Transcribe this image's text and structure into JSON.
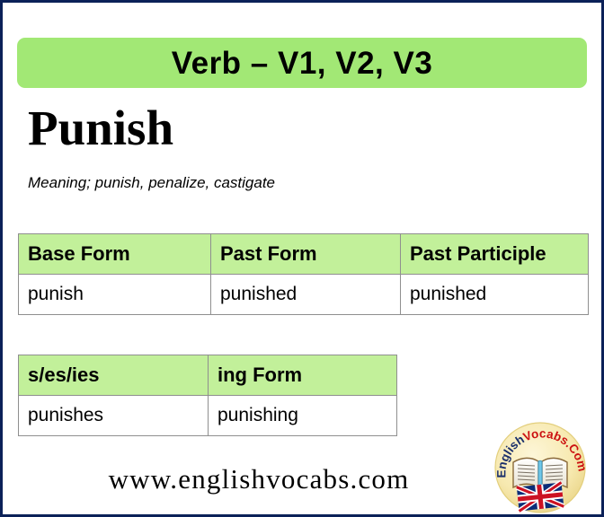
{
  "banner": {
    "title": "Verb – V1, V2, V3"
  },
  "word": {
    "headword": "Punish",
    "meaning": "Meaning; punish, penalize, castigate"
  },
  "table_forms": {
    "headers": [
      "Base Form",
      "Past Form",
      "Past Participle"
    ],
    "rows": [
      [
        "punish",
        "punished",
        "punished"
      ]
    ]
  },
  "table_inflections": {
    "headers": [
      "s/es/ies",
      "ing Form"
    ],
    "rows": [
      [
        "punishes",
        "punishing"
      ]
    ]
  },
  "footer": {
    "url": "www.englishvocabs.com"
  },
  "logo": {
    "text_primary": "English",
    "text_secondary": "Vocabs.Com",
    "primary_color": "#1a2f6b",
    "secondary_color": "#cc1111"
  },
  "colors": {
    "page_border": "#0b2158",
    "banner_green": "#a2e875",
    "table_header_green": "#c2f09a",
    "table_border": "#8f8f8f",
    "text": "#000000"
  }
}
